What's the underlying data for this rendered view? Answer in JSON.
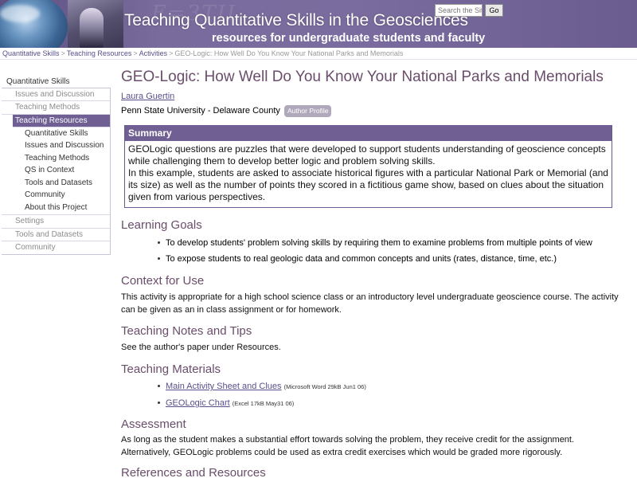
{
  "header": {
    "title": "Teaching Quantitative Skills in the Geosciences",
    "subtitle": "resources for undergraduate students and faculty",
    "search_placeholder": "Search the Site",
    "go_label": "Go"
  },
  "breadcrumb": {
    "items": [
      "Quantitative Skills",
      "Teaching Resources",
      "Activities"
    ],
    "current": "GEO-Logic: How Well Do You Know Your National Parks and Memorials",
    "separator": ">"
  },
  "sidebar": {
    "top": "Quantitative Skills",
    "items": [
      {
        "label": "Issues and Discussion"
      },
      {
        "label": "Teaching Methods"
      },
      {
        "label": "Teaching Resources"
      }
    ],
    "subitems": [
      {
        "label": "Quantitative Skills"
      },
      {
        "label": "Issues and Discussion"
      },
      {
        "label": "Teaching Methods"
      },
      {
        "label": "QS in Context"
      },
      {
        "label": "Tools and Datasets"
      },
      {
        "label": "Community"
      },
      {
        "label": "About this Project"
      }
    ],
    "bottom_items": [
      {
        "label": "Settings"
      },
      {
        "label": "Tools and Datasets"
      },
      {
        "label": "Community"
      }
    ]
  },
  "page": {
    "title": "GEO-Logic: How Well Do You Know Your National Parks and Memorials",
    "author": "Laura Guertin",
    "affiliation": "Penn State University - Delaware County",
    "author_profile": "Author Profile"
  },
  "summary": {
    "heading": "Summary",
    "p1": "GEOLogic questions are puzzles that were developed to support students understanding of geoscience concepts while challenging them to develop better logic and problem solving skills.",
    "p2": "In this example, students are asked to associate historical figures with a particular National Park or Memorial (and its size) as well as the number of points they scored in a fictitious game show, based on clues about the situation given from various perspectives."
  },
  "learning_goals": {
    "heading": "Learning Goals",
    "items": [
      "To develop students' problem solving skills by requiring them to examine problems from multiple points of view",
      "To expose students to real geologic data and common concepts and units (rates, distance, time, etc.)"
    ]
  },
  "context": {
    "heading": "Context for Use",
    "text": "This activity is appropriate for a high school science class or an introductory level undergraduate geoscience course. The activity can be given as an in class assignment or for homework."
  },
  "notes": {
    "heading": "Teaching Notes and Tips",
    "text": "See the author's paper under Resources."
  },
  "materials": {
    "heading": "Teaching Materials",
    "items": [
      {
        "label": "Main Activity Sheet and Clues",
        "meta": "(Microsoft Word 29kB Jun1 06)"
      },
      {
        "label": "GEOLogic Chart",
        "meta": "(Excel 17kB May31 06)"
      }
    ]
  },
  "assessment": {
    "heading": "Assessment",
    "text": "As long as the student makes a substantial effort towards solving the problem, they receive credit for the assignment. Alternatively, GEOLogic problems could be used as extra credit exercises which would be graded more rigorously."
  },
  "references": {
    "heading": "References and Resources"
  }
}
